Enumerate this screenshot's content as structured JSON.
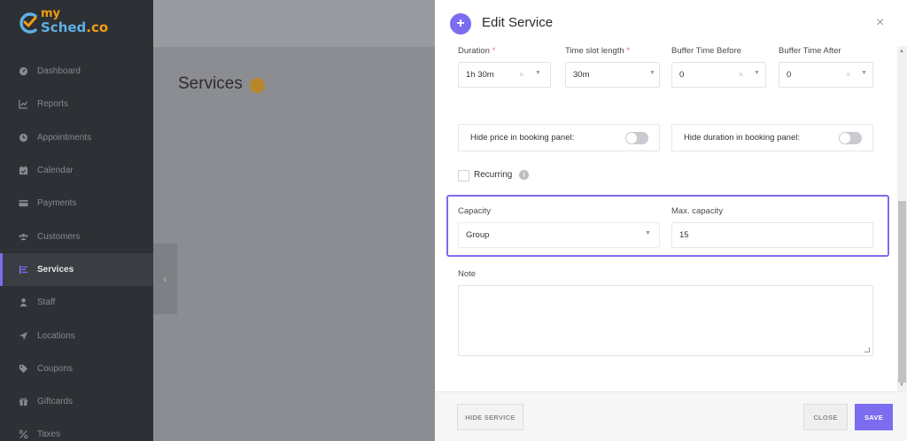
{
  "brand": {
    "line1": "my",
    "line2": "Sched",
    "line2_suffix": ".co"
  },
  "sidebar": {
    "items": [
      {
        "label": "Dashboard",
        "icon": "dashboard-icon",
        "active": false
      },
      {
        "label": "Reports",
        "icon": "chart-icon",
        "active": false
      },
      {
        "label": "Appointments",
        "icon": "clock-icon",
        "active": false
      },
      {
        "label": "Calendar",
        "icon": "calendar-icon",
        "active": false
      },
      {
        "label": "Payments",
        "icon": "card-icon",
        "active": false
      },
      {
        "label": "Customers",
        "icon": "users-icon",
        "active": false
      },
      {
        "label": "Services",
        "icon": "list-icon",
        "active": true
      },
      {
        "label": "Staff",
        "icon": "user-icon",
        "active": false
      },
      {
        "label": "Locations",
        "icon": "location-arrow-icon",
        "active": false
      },
      {
        "label": "Coupons",
        "icon": "tag-icon",
        "active": false
      },
      {
        "label": "Giftcards",
        "icon": "gift-icon",
        "active": false
      },
      {
        "label": "Taxes",
        "icon": "percent-icon",
        "active": false
      }
    ]
  },
  "page": {
    "title": "Services"
  },
  "modal": {
    "title": "Edit Service",
    "close_glyph": "×",
    "fields": {
      "duration": {
        "label": "Duration",
        "required_mark": "*",
        "value": "1h 30m"
      },
      "time_slot": {
        "label": "Time slot length",
        "required_mark": "*",
        "value": "30m"
      },
      "buffer_before": {
        "label": "Buffer Time Before",
        "value": "0"
      },
      "buffer_after": {
        "label": "Buffer Time After",
        "value": "0"
      }
    },
    "toggles": {
      "hide_price": {
        "label": "Hide price in booking panel:",
        "on": false
      },
      "hide_duration": {
        "label": "Hide duration in booking panel:",
        "on": false
      }
    },
    "recurring": {
      "label": "Recurring",
      "checked": false
    },
    "capacity": {
      "label": "Capacity",
      "value": "Group"
    },
    "max_capacity": {
      "label": "Max. capacity",
      "value": "15"
    },
    "note": {
      "label": "Note",
      "value": ""
    },
    "footer": {
      "hide_service": "HIDE SERVICE",
      "close": "CLOSE",
      "save": "SAVE"
    }
  },
  "colors": {
    "accent": "#7b6cf0",
    "sidebar_bg": "#2d3034",
    "overlay": "#8c8d92"
  }
}
